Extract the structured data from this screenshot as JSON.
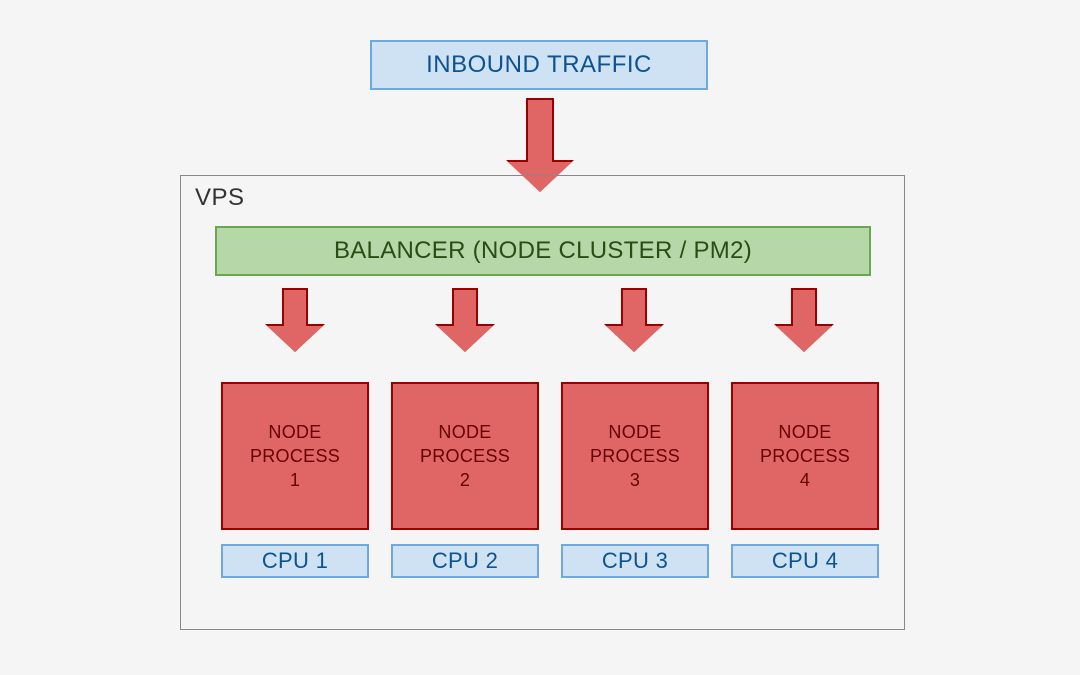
{
  "inbound_label": "INBOUND TRAFFIC",
  "vps_label": "VPS",
  "balancer_label": "BALANCER (NODE CLUSTER / PM2)",
  "processes": [
    {
      "line1": "NODE",
      "line2": "PROCESS",
      "line3": "1"
    },
    {
      "line1": "NODE",
      "line2": "PROCESS",
      "line3": "2"
    },
    {
      "line1": "NODE",
      "line2": "PROCESS",
      "line3": "3"
    },
    {
      "line1": "NODE",
      "line2": "PROCESS",
      "line3": "4"
    }
  ],
  "cpus": [
    "CPU 1",
    "CPU 2",
    "CPU 3",
    "CPU 4"
  ],
  "colors": {
    "blue_fill": "#cfe2f3",
    "blue_border": "#6fa8dc",
    "green_fill": "#b6d7a8",
    "green_border": "#6aa84f",
    "red_fill": "#e06666",
    "red_border": "#990000"
  }
}
